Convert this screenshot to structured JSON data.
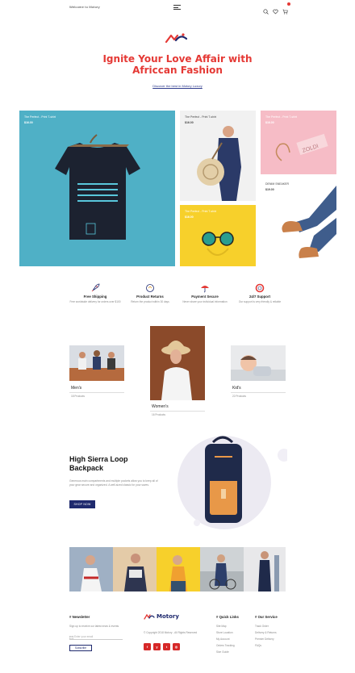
{
  "header": {
    "welcome": "Welcome to Motory",
    "icons": [
      "menu-icon",
      "search-icon",
      "heart-icon",
      "cart-icon"
    ]
  },
  "hero": {
    "title": "Ignite Your Love Affair with Africcan Fashion",
    "link": "Discover the best in Motory Luxury"
  },
  "tiles": [
    {
      "label": "The Perfect - Print T-shirt",
      "price": "$16.00"
    },
    {
      "label": "The Perfect - Print T-shirt",
      "price": "$16.00"
    },
    {
      "label": "The Perfect - Print T-shirt",
      "price": "$16.00"
    },
    {
      "label": "The Perfect - Print T-shirt",
      "price": "$16.00"
    },
    {
      "label": "DENIM SNEAKER",
      "price": "$19.00"
    }
  ],
  "features": [
    {
      "title": "Free Shipping",
      "desc": "Free worldwide delivery for orders over $100",
      "icon": "rocket-icon"
    },
    {
      "title": "Product Returns",
      "desc": "Return the product within 30 days",
      "icon": "return-icon"
    },
    {
      "title": "Payment Secure",
      "desc": "Never share your individual information",
      "icon": "umbrella-icon"
    },
    {
      "title": "24/7 Support",
      "desc": "Our support is very friendly & reliable",
      "icon": "lifebuoy-icon"
    }
  ],
  "categories": [
    {
      "name": "Men's",
      "count": "18 Products"
    },
    {
      "name": "Women's",
      "count": "16 Products"
    },
    {
      "name": "Kid's",
      "count": "22 Products"
    }
  ],
  "featured": {
    "title": "High Sierra Loop Backpack",
    "desc": "Generous main compartments and multiple pockets allow you to keep all of your gear secure and organized. A well-sized classic for your saves.",
    "button": "SHOP NOW"
  },
  "footer": {
    "newsletter_title": "# Newsletter",
    "newsletter_text": "Sign up to receive our latest news & events",
    "email_placeholder": "Enter your email",
    "subscribe": "Subscribe",
    "brand": "Motory",
    "copyright": "© Copyright 2018 Motory - All Rights Reserved",
    "quick_title": "# Quick Links",
    "quick_links": [
      "Site Map",
      "Store Location",
      "My Account",
      "Orders Tracking",
      "Size Guide"
    ],
    "service_title": "# Our Service",
    "service_links": [
      "Track Order",
      "Delivery & Returns",
      "Premier Delivery",
      "FAQs"
    ],
    "socials": [
      "f",
      "y",
      "t",
      "◎"
    ]
  },
  "colors": {
    "accent": "#e53935",
    "navy": "#1f2a6e",
    "teal": "#4fb0c6",
    "pink": "#f6bcc6",
    "yellow": "#f7d02b"
  }
}
